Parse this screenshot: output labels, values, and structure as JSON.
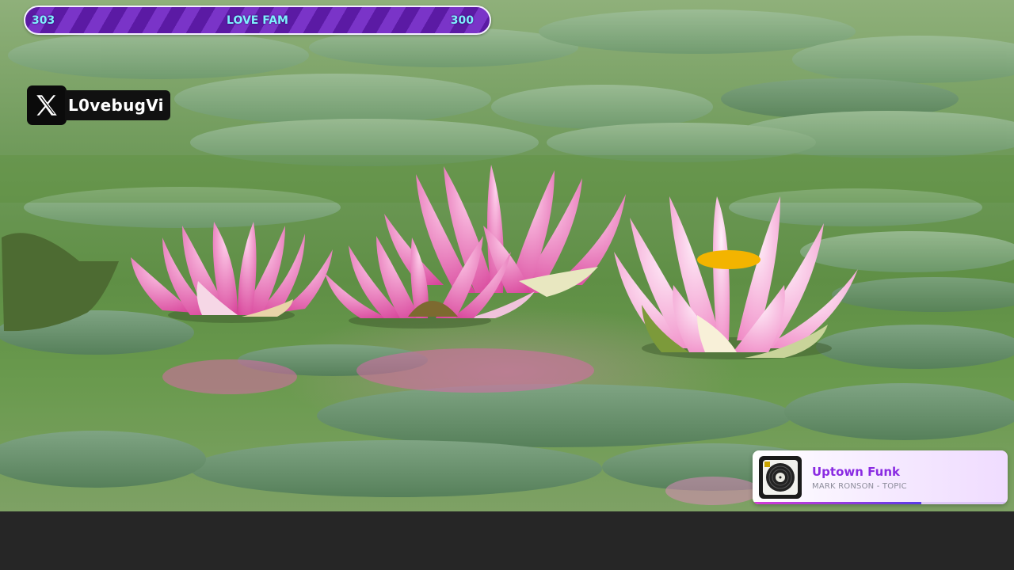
{
  "goal_bar": {
    "left_count": "303",
    "title": "LOVE FAM",
    "right_count": "300"
  },
  "social": {
    "platform_icon": "x-logo-icon",
    "handle": "L0vebugVi"
  },
  "now_playing": {
    "title": "Uptown Funk",
    "artist": "MARK RONSON - TOPIC",
    "progress_fraction": 0.66,
    "album_icon": "vinyl-record-icon"
  },
  "colors": {
    "goal_bar_purple": "#5b1aa4",
    "goal_bar_text": "#7ff0ff",
    "now_playing_title": "#8a2be2",
    "letterbox": "#262626"
  }
}
